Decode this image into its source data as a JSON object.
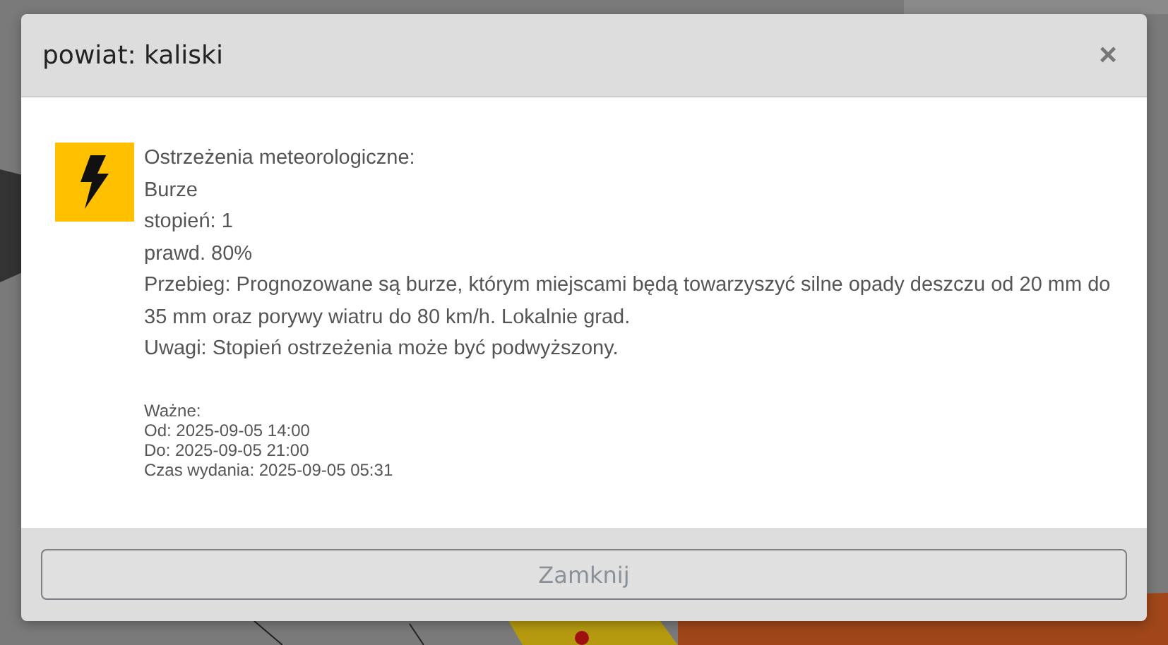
{
  "dialog": {
    "title": "powiat: kaliski",
    "close": "×",
    "warning": {
      "lines": [
        "Ostrzeżenia meteorologiczne:",
        "Burze",
        "stopień: 1",
        "prawd. 80%",
        "Przebieg: Prognozowane są burze, którym miejscami będą towarzyszyć silne opady deszczu od 20 mm do 35 mm oraz porywy wiatru do 80 km/h. Lokalnie grad.",
        "Uwagi: Stopień ostrzeżenia może być podwyższony."
      ],
      "color": "#ffc000"
    },
    "validity": [
      "Ważne:",
      "Od: 2025-09-05 14:00",
      "Do: 2025-09-05 21:00",
      "Czas wydania: 2025-09-05 05:31"
    ],
    "buttons": [
      "Zamknij"
    ]
  }
}
